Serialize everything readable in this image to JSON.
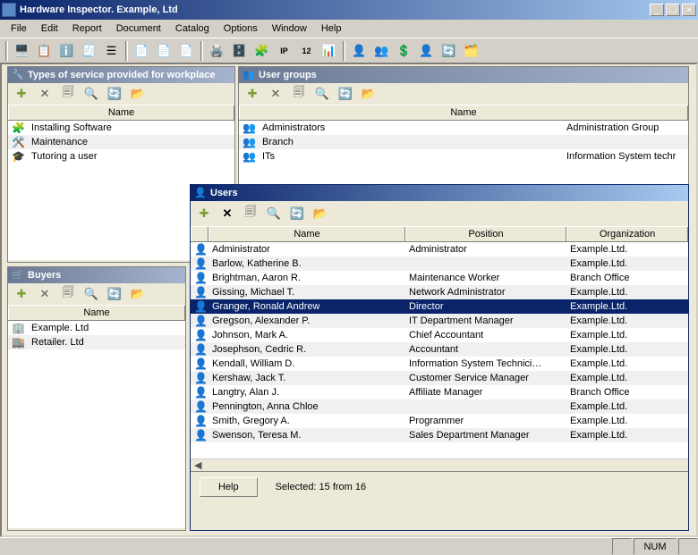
{
  "window": {
    "title": "Hardware Inspector. Example, Ltd",
    "minimize": "_",
    "maximize": "☐",
    "close": "×"
  },
  "menu": {
    "file": "File",
    "edit": "Edit",
    "report": "Report",
    "document": "Document",
    "catalog": "Catalog",
    "options": "Options",
    "window": "Window",
    "help": "Help"
  },
  "toolbar_icons": {
    "tool1": "🖥️",
    "tool2": "📋",
    "tool3": "ℹ️",
    "tool4": "🧾",
    "tool5": "☰",
    "tool6": "📄",
    "tool7": "📄",
    "tool8": "📄",
    "tool9": "🖨️",
    "tool10": "🗄️",
    "tool11": "🧩",
    "tool12": "IP",
    "tool13": "12",
    "tool14": "📊",
    "tool15": "👤",
    "tool16": "👥",
    "tool17": "💲",
    "tool18": "👤",
    "tool19": "🔄",
    "tool20": "🗂️"
  },
  "panels": {
    "types": {
      "title": "Types of service provided for workplace",
      "header": {
        "name": "Name"
      },
      "rows": [
        {
          "icon": "🧩",
          "name": "Installing Software"
        },
        {
          "icon": "🛠️",
          "name": "Maintenance"
        },
        {
          "icon": "🎓",
          "name": "Tutoring a user"
        }
      ]
    },
    "groups": {
      "title": "User groups",
      "header": {
        "name": "Name",
        "desc": ""
      },
      "rows": [
        {
          "icon": "👥",
          "name": "Administrators",
          "desc": "Administration Group"
        },
        {
          "icon": "👥",
          "name": "Branch",
          "desc": ""
        },
        {
          "icon": "👥",
          "name": "ITs",
          "desc": "Information System techr"
        }
      ]
    },
    "buyers": {
      "title": "Buyers",
      "header": {
        "name": "Name"
      },
      "rows": [
        {
          "icon": "🏢",
          "name": "Example. Ltd"
        },
        {
          "icon": "🏬",
          "name": "Retailer. Ltd"
        }
      ]
    },
    "users": {
      "title": "Users",
      "header": {
        "name": "Name",
        "position": "Position",
        "org": "Organization"
      },
      "rows": [
        {
          "icon": "👤",
          "name": "Administrator",
          "position": "Administrator",
          "org": "Example.Ltd."
        },
        {
          "icon": "👤",
          "name": "Barlow, Katherine B.",
          "position": "",
          "org": "Example.Ltd."
        },
        {
          "icon": "👤",
          "name": "Brightman, Aaron R.",
          "position": "Maintenance Worker",
          "org": "Branch Office"
        },
        {
          "icon": "👤",
          "name": "Gissing, Michael T.",
          "position": "Network Administrator",
          "org": "Example.Ltd."
        },
        {
          "icon": "👤",
          "name": "Granger, Ronald Andrew",
          "position": "Director",
          "org": "Example.Ltd.",
          "selected": true
        },
        {
          "icon": "👤",
          "name": "Gregson, Alexander P.",
          "position": "IT Department Manager",
          "org": "Example.Ltd."
        },
        {
          "icon": "👤",
          "name": "Johnson, Mark A.",
          "position": "Chief Accountant",
          "org": "Example.Ltd."
        },
        {
          "icon": "👤",
          "name": "Josephson, Cedric R.",
          "position": "Accountant",
          "org": "Example.Ltd."
        },
        {
          "icon": "👤",
          "name": "Kendall, William D.",
          "position": "Information System Technici…",
          "org": "Example.Ltd."
        },
        {
          "icon": "👤",
          "name": "Kershaw, Jack T.",
          "position": "Customer Service Manager",
          "org": "Example.Ltd."
        },
        {
          "icon": "👤",
          "name": "Langtry, Alan J.",
          "position": "Affiliate Manager",
          "org": "Branch Office"
        },
        {
          "icon": "👤",
          "name": "Pennington, Anna Chloe",
          "position": "",
          "org": "Example.Ltd."
        },
        {
          "icon": "👤",
          "name": "Smith, Gregory A.",
          "position": "Programmer",
          "org": "Example.Ltd."
        },
        {
          "icon": "👤",
          "name": "Swenson, Teresa M.",
          "position": "Sales Department Manager",
          "org": "Example.Ltd."
        }
      ],
      "toolbar": {
        "add": "✚",
        "del": "✕",
        "dup": "🗐",
        "search": "🔍",
        "refresh": "🔄",
        "open": "📂"
      },
      "scroll_hint": "◀",
      "help_label": "Help",
      "status": "Selected: 15 from 16"
    }
  },
  "panel_toolbar": {
    "add": "✚",
    "del": "✕",
    "dup": "🗐",
    "search": "🔍",
    "refresh": "🔄",
    "open": "📂"
  },
  "statusbar": {
    "num": "NUM"
  }
}
